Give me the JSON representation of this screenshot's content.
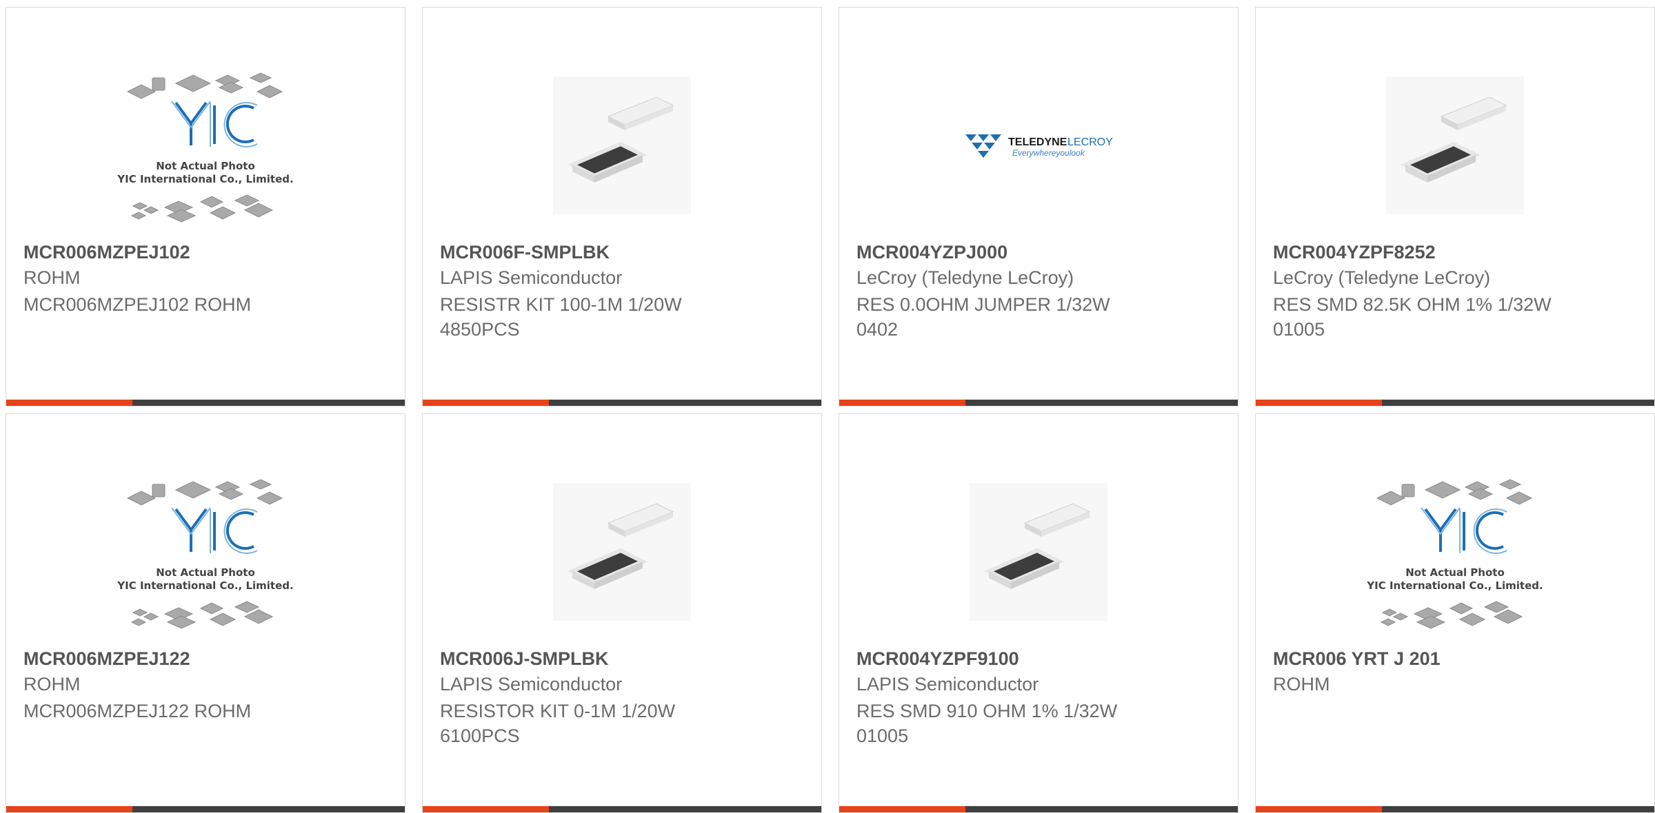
{
  "theme": {
    "accent": "#e8431a",
    "bar": "#3f3f3f",
    "yic_blue": "#1c6fb6",
    "teledyne_blue": "#1e6fb0"
  },
  "yic_placeholder": {
    "logo_text": "YIC",
    "line1": "Not Actual Photo",
    "line2": "YIC International Co., Limited."
  },
  "teledyne_logo": {
    "name": "TELEDYNE",
    "name2": "LECROY",
    "tagline": "Everywhereyoulook"
  },
  "products": [
    {
      "part": "MCR006MZPEJ102",
      "maker": "ROHM",
      "desc": "MCR006MZPEJ102 ROHM",
      "image": "yic-placeholder"
    },
    {
      "part": "MCR006F-SMPLBK",
      "maker": "LAPIS Semiconductor",
      "desc": "RESISTR KIT 100-1M 1/20W 4850PCS",
      "image": "smd-resistor"
    },
    {
      "part": "MCR004YZPJ000",
      "maker": "LeCroy (Teledyne LeCroy)",
      "desc": "RES 0.0OHM JUMPER 1/32W 0402",
      "image": "teledyne-logo"
    },
    {
      "part": "MCR004YZPF8252",
      "maker": "LeCroy (Teledyne LeCroy)",
      "desc": "RES SMD 82.5K OHM 1% 1/32W 01005",
      "image": "smd-resistor"
    },
    {
      "part": "MCR006MZPEJ122",
      "maker": "ROHM",
      "desc": "MCR006MZPEJ122 ROHM",
      "image": "yic-placeholder"
    },
    {
      "part": "MCR006J-SMPLBK",
      "maker": "LAPIS Semiconductor",
      "desc": "RESISTOR KIT 0-1M 1/20W 6100PCS",
      "image": "smd-resistor"
    },
    {
      "part": "MCR004YZPF9100",
      "maker": "LAPIS Semiconductor",
      "desc": "RES SMD 910 OHM 1% 1/32W 01005",
      "image": "smd-resistor"
    },
    {
      "part": "MCR006 YRT J 201",
      "maker": "ROHM",
      "desc": "",
      "image": "yic-placeholder"
    }
  ]
}
